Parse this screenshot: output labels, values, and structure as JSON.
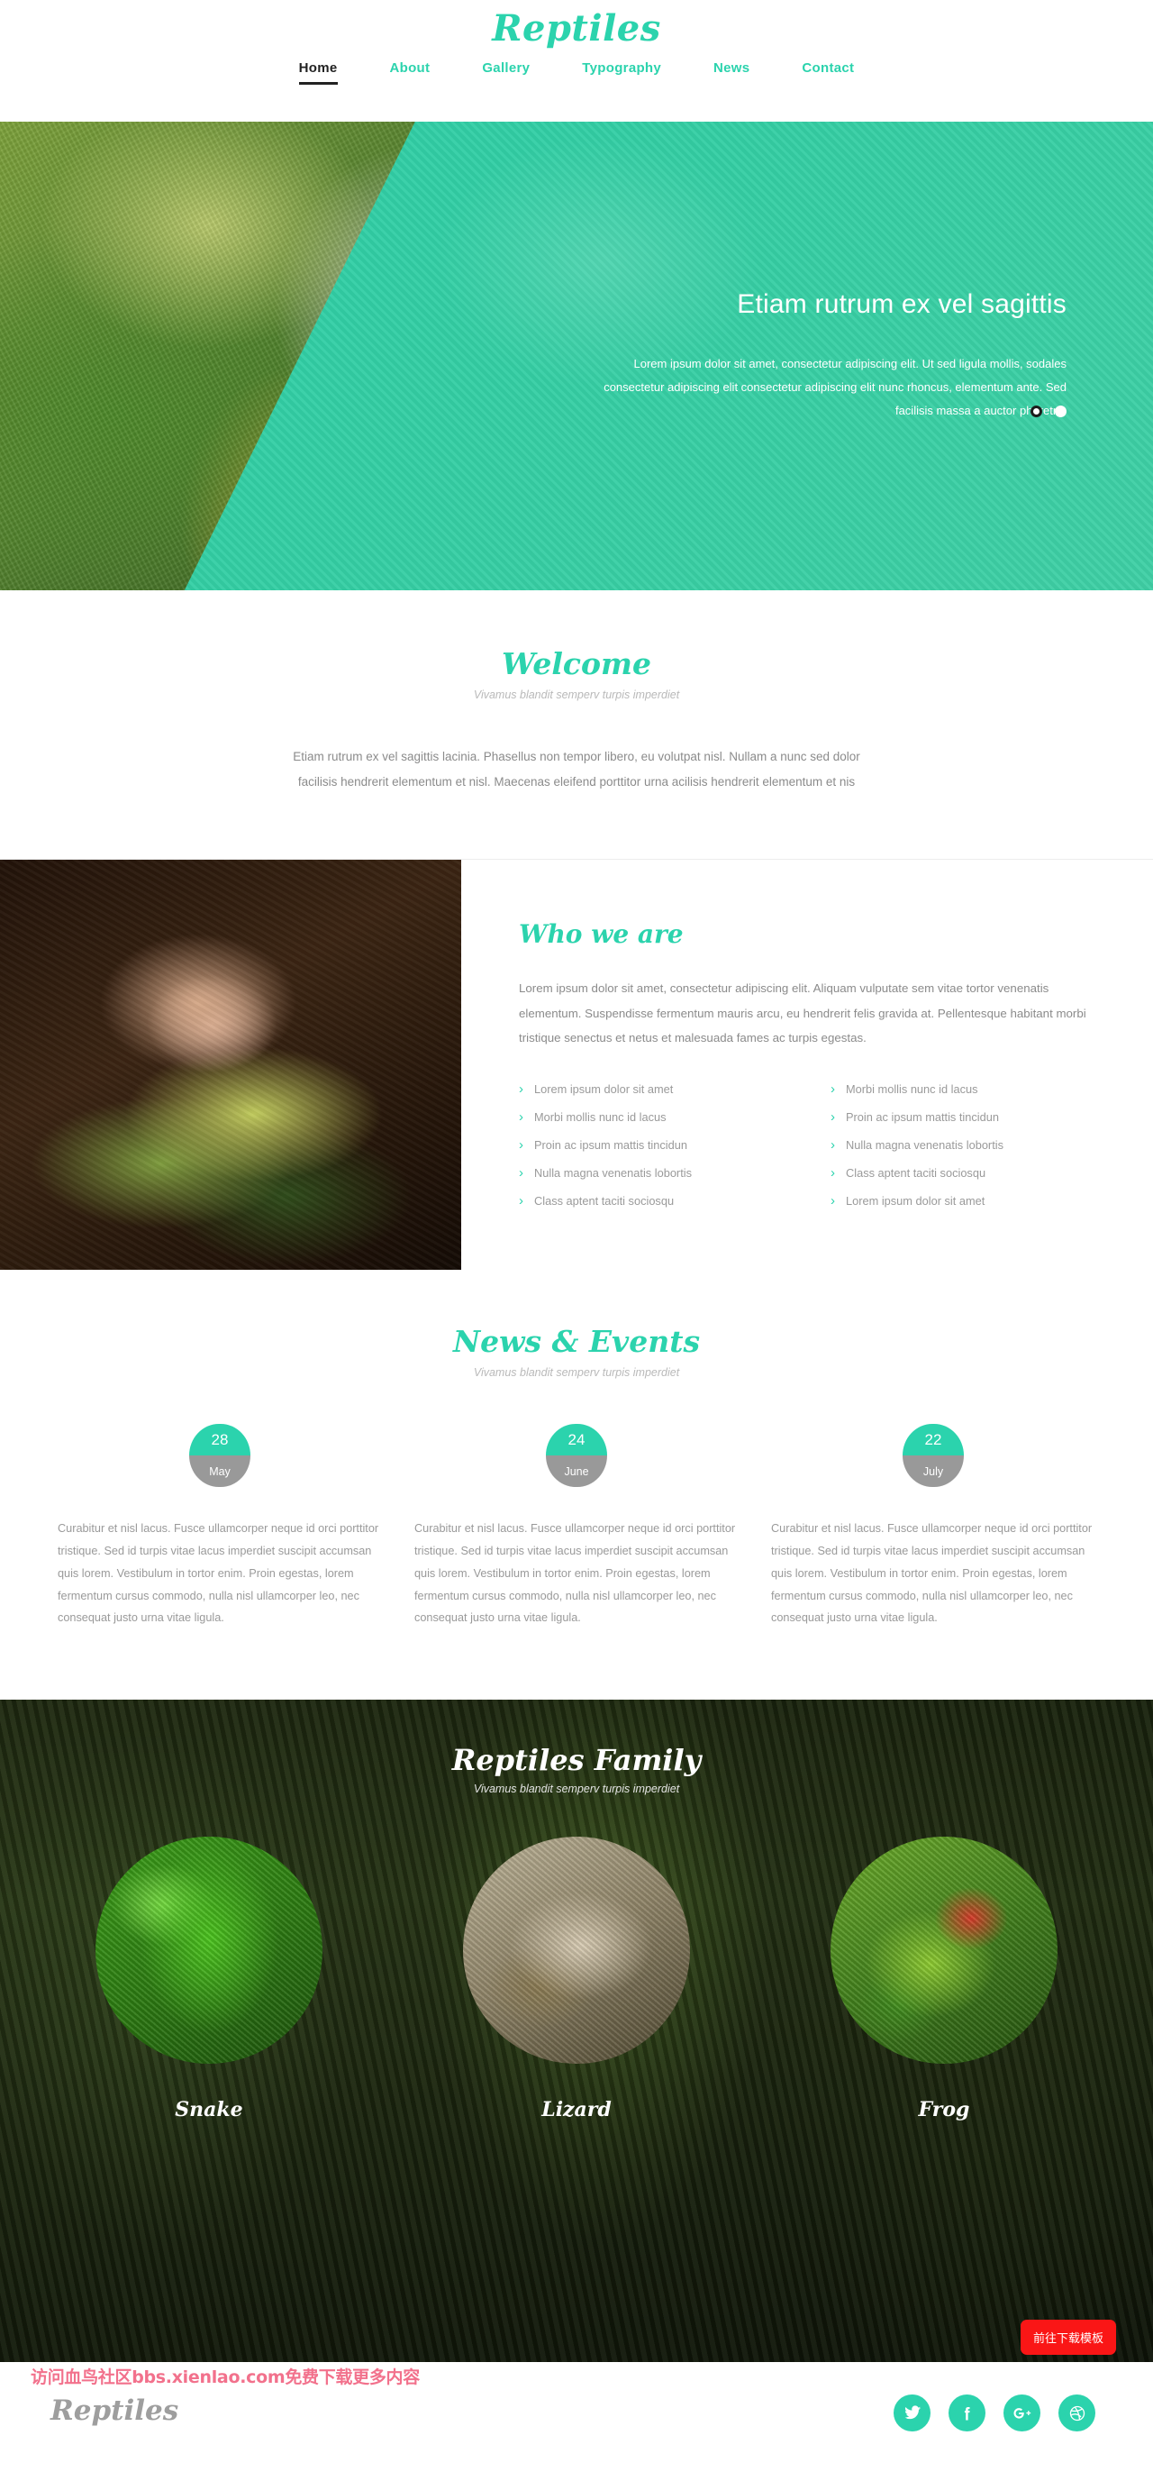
{
  "brand": "Reptiles",
  "nav": {
    "items": [
      {
        "label": "Home",
        "active": true
      },
      {
        "label": "About",
        "active": false
      },
      {
        "label": "Gallery",
        "active": false
      },
      {
        "label": "Typography",
        "active": false
      },
      {
        "label": "News",
        "active": false
      },
      {
        "label": "Contact",
        "active": false
      }
    ]
  },
  "hero": {
    "title": "Etiam rutrum ex vel sagittis",
    "description": "Lorem ipsum dolor sit amet, consectetur adipiscing elit. Ut sed ligula mollis, sodales consectetur adipiscing elit consectetur adipiscing elit nunc rhoncus, elementum ante. Sed facilisis massa a auctor pharetra.",
    "slides": [
      {
        "label": "1",
        "active": true
      },
      {
        "label": "2",
        "active": false
      }
    ]
  },
  "welcome": {
    "title": "Welcome",
    "subtitle": "Vivamus blandit semperv turpis imperdiet",
    "body": "Etiam rutrum ex vel sagittis lacinia. Phasellus non tempor libero, eu volutpat nisl. Nullam a nunc sed dolor facilisis hendrerit elementum et nisl. Maecenas eleifend porttitor urna acilisis hendrerit elementum et nis"
  },
  "who": {
    "title": "Who we are",
    "description": "Lorem ipsum dolor sit amet, consectetur adipiscing elit. Aliquam vulputate sem vitae tortor venenatis elementum. Suspendisse fermentum mauris arcu, eu hendrerit felis gravida at. Pellentesque habitant morbi tristique senectus et netus et malesuada fames ac turpis egestas.",
    "list_left": [
      "Lorem ipsum dolor sit amet",
      "Morbi mollis nunc id lacus",
      "Proin ac ipsum mattis tincidun",
      "Nulla magna venenatis lobortis",
      "Class aptent taciti sociosqu"
    ],
    "list_right": [
      "Morbi mollis nunc id lacus",
      "Proin ac ipsum mattis tincidun",
      "Nulla magna venenatis lobortis",
      "Class aptent taciti sociosqu",
      "Lorem ipsum dolor sit amet"
    ]
  },
  "news": {
    "title": "News & Events",
    "subtitle": "Vivamus blandit semperv turpis imperdiet",
    "items": [
      {
        "day": "28",
        "month": "May",
        "text": "Curabitur et nisl lacus. Fusce ullamcorper neque id orci porttitor tristique. Sed id turpis vitae lacus imperdiet suscipit accumsan quis lorem. Vestibulum in tortor enim. Proin egestas, lorem fermentum cursus commodo, nulla nisl ullamcorper leo, nec consequat justo urna vitae ligula."
      },
      {
        "day": "24",
        "month": "June",
        "text": "Curabitur et nisl lacus. Fusce ullamcorper neque id orci porttitor tristique. Sed id turpis vitae lacus imperdiet suscipit accumsan quis lorem. Vestibulum in tortor enim. Proin egestas, lorem fermentum cursus commodo, nulla nisl ullamcorper leo, nec consequat justo urna vitae ligula."
      },
      {
        "day": "22",
        "month": "July",
        "text": "Curabitur et nisl lacus. Fusce ullamcorper neque id orci porttitor tristique. Sed id turpis vitae lacus imperdiet suscipit accumsan quis lorem. Vestibulum in tortor enim. Proin egestas, lorem fermentum cursus commodo, nulla nisl ullamcorper leo, nec consequat justo urna vitae ligula."
      }
    ]
  },
  "family": {
    "title": "Reptiles Family",
    "subtitle": "Vivamus blandit semperv turpis imperdiet",
    "members": [
      {
        "label": "Snake"
      },
      {
        "label": "Lizard"
      },
      {
        "label": "Frog"
      }
    ]
  },
  "footer": {
    "logo": "Reptiles",
    "social": [
      {
        "name": "twitter-icon"
      },
      {
        "name": "facebook-icon"
      },
      {
        "name": "google-plus-icon"
      },
      {
        "name": "dribbble-icon"
      }
    ]
  },
  "overlay": {
    "download_button": "前往下载模板",
    "watermark": "访问血鸟社区bbs.xienlao.com免费下载更多内容"
  },
  "colors": {
    "accent": "#2bd3ad",
    "hero_overlay": "#34cfa4",
    "date_month_bg": "#999999",
    "download_button_bg": "#fa1616",
    "watermark": "#f2718c"
  }
}
